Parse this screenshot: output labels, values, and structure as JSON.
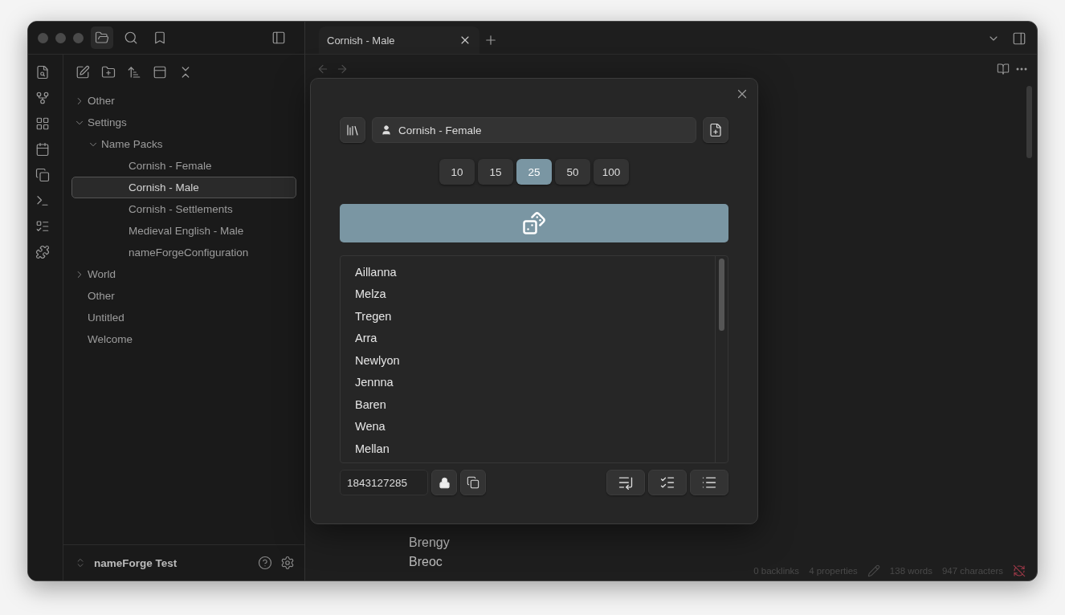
{
  "vault": {
    "name": "nameForge Test"
  },
  "tree": [
    {
      "label": "Other",
      "kind": "folder",
      "expanded": false,
      "selected": false
    },
    {
      "label": "Settings",
      "kind": "folder",
      "expanded": true,
      "selected": false,
      "children": [
        {
          "label": "Name Packs",
          "kind": "folder",
          "expanded": true,
          "selected": false,
          "children": [
            {
              "label": "Cornish - Female",
              "kind": "file",
              "selected": false
            },
            {
              "label": "Cornish - Male",
              "kind": "file",
              "selected": true
            },
            {
              "label": "Cornish - Settlements",
              "kind": "file",
              "selected": false
            },
            {
              "label": "Medieval English - Male",
              "kind": "file",
              "selected": false
            },
            {
              "label": "nameForgeConfiguration",
              "kind": "file",
              "selected": false
            }
          ]
        }
      ]
    },
    {
      "label": "World",
      "kind": "folder",
      "expanded": false,
      "selected": false
    },
    {
      "label": "Other",
      "kind": "file",
      "selected": false
    },
    {
      "label": "Untitled",
      "kind": "file",
      "selected": false
    },
    {
      "label": "Welcome",
      "kind": "file",
      "selected": false
    }
  ],
  "tabs": [
    {
      "title": "Cornish - Male",
      "selected": true
    }
  ],
  "editor": {
    "lines": [
      "Brengy",
      "Breoc"
    ]
  },
  "status_bar": {
    "backlinks": "0 backlinks",
    "properties": "4 properties",
    "words": "138 words",
    "characters": "947 characters"
  },
  "modal": {
    "pack": "Cornish - Female",
    "counts": [
      {
        "label": "10",
        "selected": false
      },
      {
        "label": "15",
        "selected": false
      },
      {
        "label": "25",
        "selected": true
      },
      {
        "label": "50",
        "selected": false
      },
      {
        "label": "100",
        "selected": false
      }
    ],
    "names": [
      "Aillanna",
      "Melza",
      "Tregen",
      "Arra",
      "Newlyon",
      "Jennna",
      "Baren",
      "Wena",
      "Mellan"
    ],
    "seed": "1843127285"
  }
}
